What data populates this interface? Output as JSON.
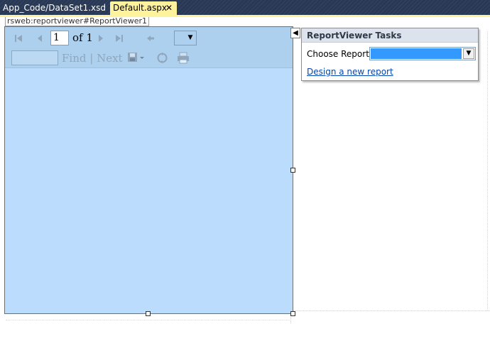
{
  "tabs": [
    {
      "label": "App_Code/DataSet1.xsd"
    },
    {
      "label": "Default.aspx",
      "close": "✕"
    }
  ],
  "designer": {
    "control_label": "rsweb:reportviewer#ReportViewer1"
  },
  "report_viewer": {
    "page_number": "1",
    "page_of": "of 1",
    "find_label": "Find",
    "separator": "|",
    "next_label": "Next"
  },
  "tasks_panel": {
    "title": "ReportViewer Tasks",
    "choose_report_label": "Choose Report",
    "choose_report_value": "",
    "design_link": "Design a new report"
  },
  "icons": [
    "first-page-icon",
    "prev-page-icon",
    "next-page-icon",
    "last-page-icon",
    "back-icon",
    "export-icon",
    "refresh-icon",
    "print-icon",
    "smart-tag-icon",
    "dropdown-arrow-icon"
  ],
  "colors": {
    "tabstrip": "#293955",
    "active_tab": "#fff29d",
    "viewer_body": "#bbdcfd",
    "viewer_toolbar": "#acd0ee",
    "selection": "#3399ff"
  }
}
